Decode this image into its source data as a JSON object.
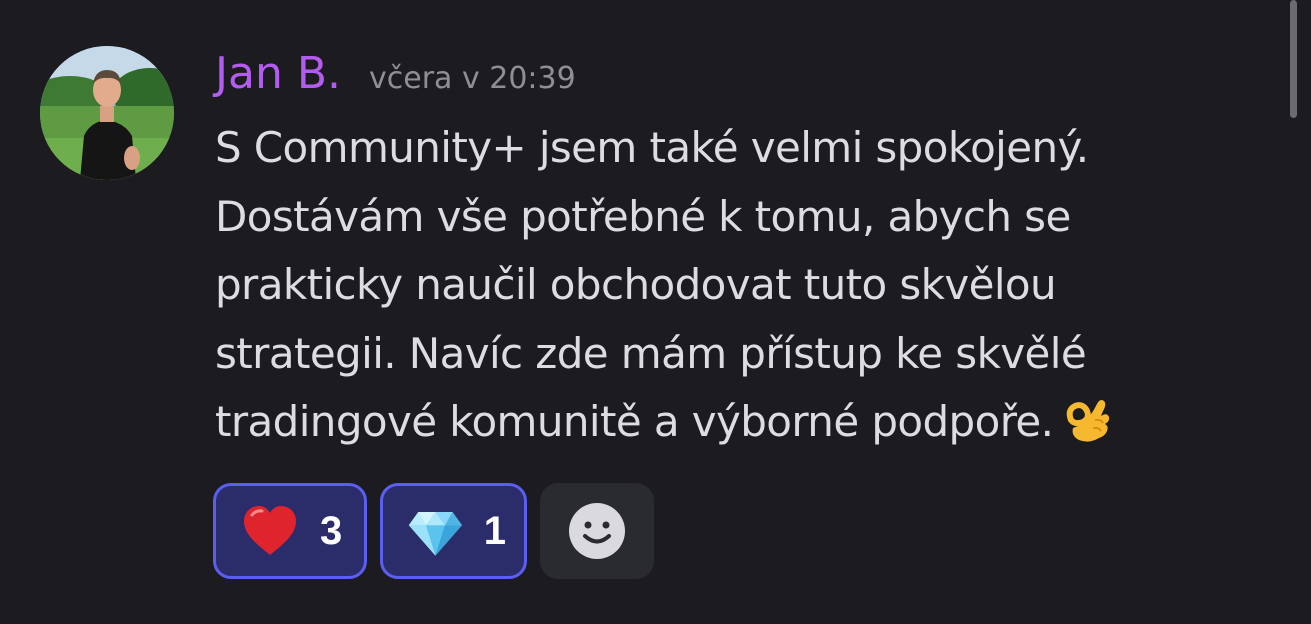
{
  "message": {
    "author": "Jan B.",
    "timestamp": "včera v 20:39",
    "lines": [
      "S Community+ jsem také velmi spokojený.",
      "Dostávám vše potřebné k tomu, abych se",
      "prakticky naučil obchodovat tuto skvělou",
      "strategii. Navíc zde mám přístup ke skvělé",
      "tradingové komunitě a výborné podpoře."
    ],
    "trailing_emoji": "ok-hand-icon"
  },
  "reactions": [
    {
      "icon": "heart-icon",
      "count": "3"
    },
    {
      "icon": "diamond-icon",
      "count": "1"
    }
  ],
  "add_reaction": {
    "icon": "smiley-icon"
  },
  "colors": {
    "background": "#1c1b20",
    "author": "#b45cf0",
    "timestamp": "#8e8f96",
    "text": "#dcdde1",
    "reaction_bg": "#2b2d6a",
    "reaction_border": "#5a5ff0",
    "add_reaction_bg": "#2a2a31"
  }
}
